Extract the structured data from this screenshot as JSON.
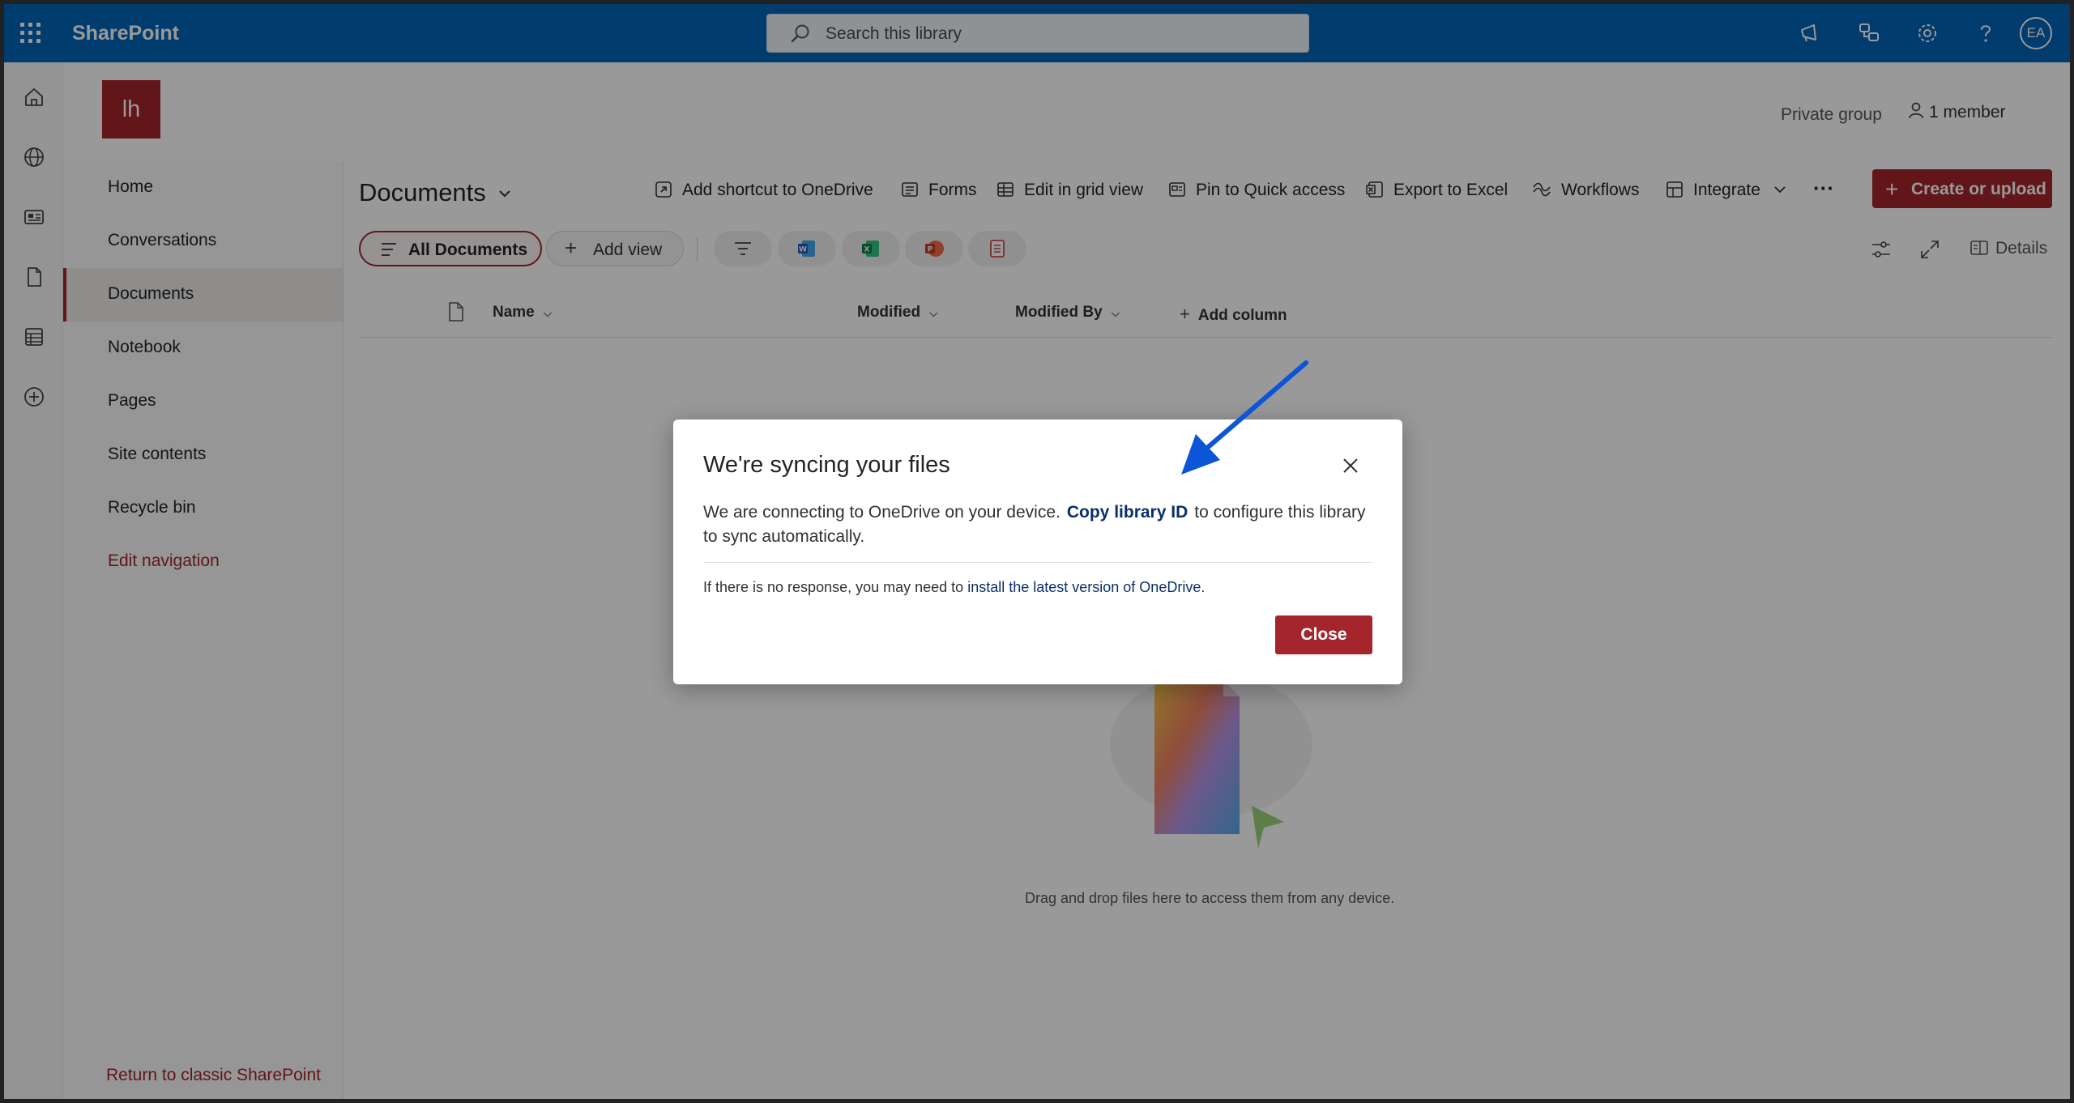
{
  "suite": {
    "brand": "SharePoint",
    "search_placeholder": "Search this library",
    "avatar_initials": "EA"
  },
  "site": {
    "logo_initials": "lh",
    "group_type": "Private group",
    "members": "1 member"
  },
  "leftnav": {
    "items": [
      {
        "label": "Home"
      },
      {
        "label": "Conversations"
      },
      {
        "label": "Documents"
      },
      {
        "label": "Notebook"
      },
      {
        "label": "Pages"
      },
      {
        "label": "Site contents"
      },
      {
        "label": "Recycle bin"
      }
    ],
    "edit_navigation": "Edit navigation",
    "return_classic": "Return to classic SharePoint"
  },
  "library": {
    "title": "Documents",
    "commands": {
      "add_shortcut": "Add shortcut to OneDrive",
      "forms": "Forms",
      "edit_grid": "Edit in grid view",
      "pin": "Pin to Quick access",
      "export": "Export to Excel",
      "workflows": "Workflows",
      "integrate": "Integrate",
      "more": "···"
    },
    "create_upload": "Create or upload",
    "views": {
      "all_documents": "All Documents",
      "add_view": "Add view",
      "details": "Details"
    },
    "columns": {
      "name": "Name",
      "modified": "Modified",
      "modified_by": "Modified By",
      "add_column": "Add column"
    },
    "empty_text": "Drag and drop files here to access them from any device."
  },
  "dialog": {
    "title": "We're syncing your files",
    "body_before": "We are connecting to OneDrive on your device.",
    "copy_link": "Copy library ID",
    "body_after": "to configure this library to sync automatically.",
    "note_before": "If there is no response, you may need to",
    "note_link": "install the latest version of OneDrive",
    "note_after": ".",
    "close_button": "Close"
  },
  "colors": {
    "suitebar": "#0364b8",
    "accent": "#a4262c",
    "link": "#0a2f6b",
    "annotation_arrow": "#0b55d6"
  }
}
